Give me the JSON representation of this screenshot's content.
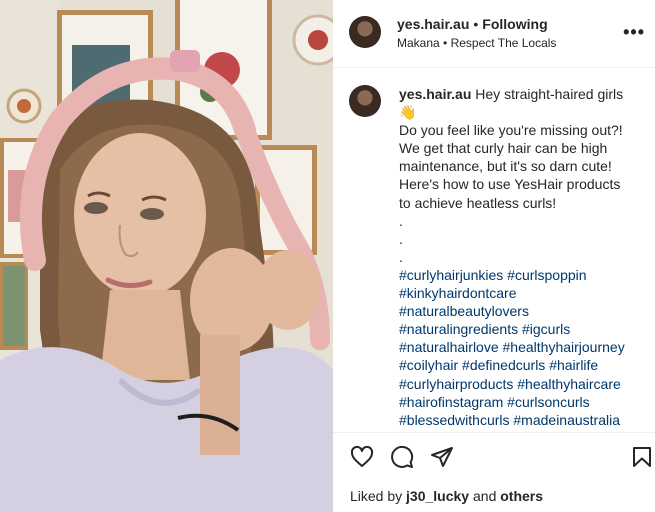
{
  "post": {
    "username": "yes.hair.au",
    "separator": "•",
    "follow_status": "Following",
    "audio": "Makana",
    "audio_separator": "•",
    "location": "Respect The Locals",
    "more": "•••"
  },
  "caption": {
    "username": "yes.hair.au",
    "first_line": "Hey straight-haired girls",
    "emoji": "👋",
    "lines": [
      "Do you feel like you're missing out?!",
      "We get that curly hair can be high",
      "maintenance, but it's so darn cute!",
      "Here's how to use YesHair products",
      "to achieve heatless curls!",
      ".",
      ".",
      "."
    ],
    "hashtags": [
      "#curlyhairjunkies #curlspoppin",
      "#kinkyhairdontcare",
      "#naturalbeautylovers",
      "#naturalingredients #igcurls",
      "#naturalhairlove #healthyhairjourney",
      "#coilyhair #definedcurls #hairlife",
      "#curlyhairproducts #healthyhaircare",
      "#hairofinstagram #curlsoncurls",
      "#blessedwithcurls #madeinaustralia"
    ]
  },
  "likes": {
    "prefix": "Liked by",
    "user": "j30_lucky",
    "joiner": "and",
    "others": "others"
  },
  "icons": {
    "like": "heart-icon",
    "comment": "comment-icon",
    "share": "share-icon",
    "save": "bookmark-icon"
  },
  "colors": {
    "text": "#262626",
    "hashtag": "#00376b",
    "divider": "#efefef"
  }
}
